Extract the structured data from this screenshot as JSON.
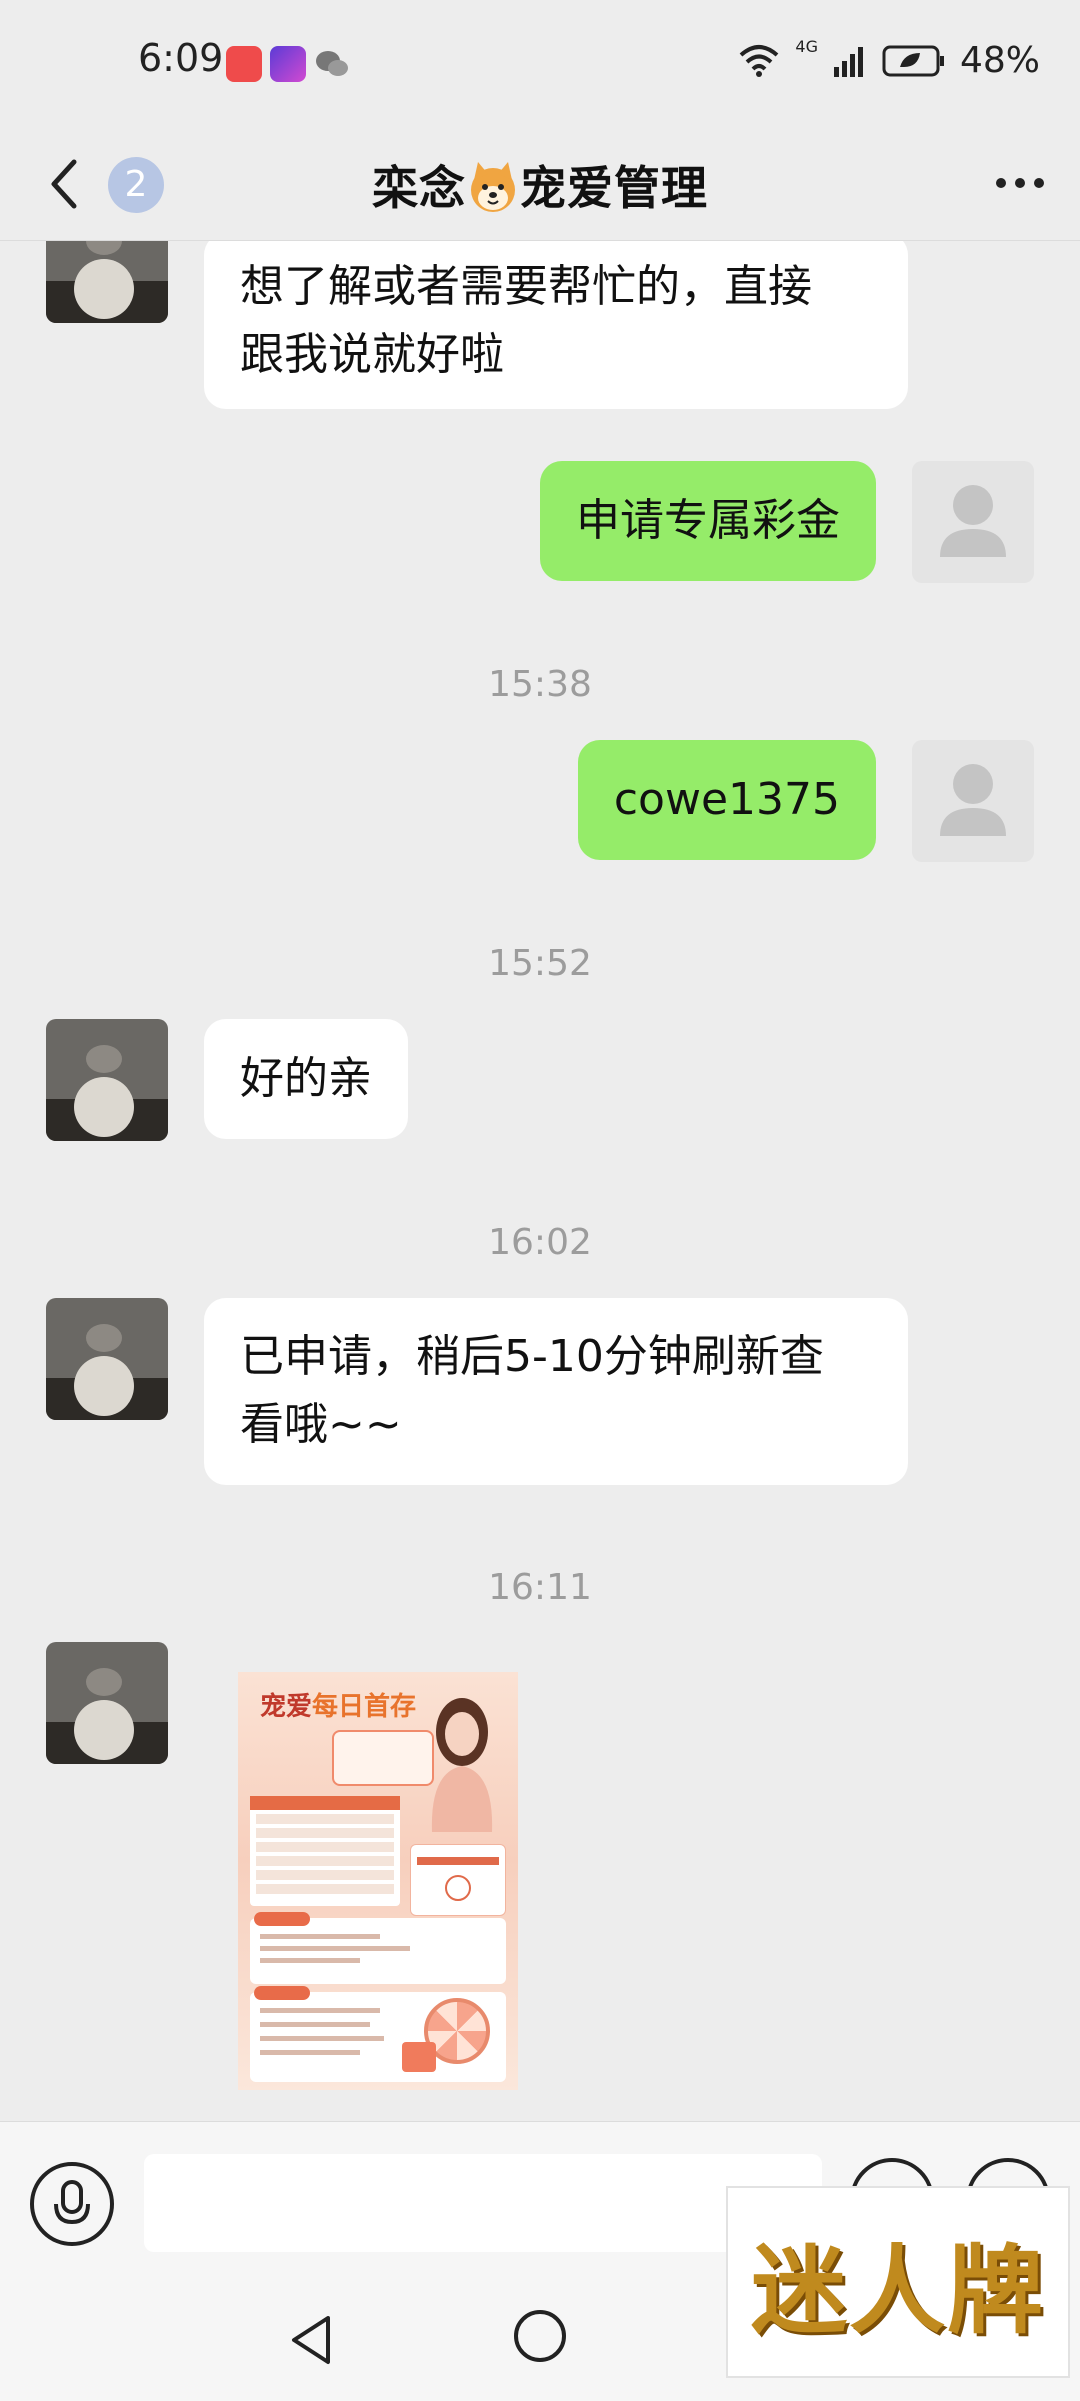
{
  "status_bar": {
    "time": "6:09",
    "battery": "48%",
    "network": "4G"
  },
  "header": {
    "unread_count": "2",
    "title_left": "栾念",
    "title_right": "宠爱管理",
    "title_emoji": "shiba-dog-emoji"
  },
  "messages": [
    {
      "id": "m1",
      "side": "in",
      "lines": [
        "想了解或者需要帮忙的，直接",
        "跟我说就好啦"
      ]
    },
    {
      "id": "m2",
      "side": "out",
      "text": "申请专属彩金"
    },
    {
      "id": "t1",
      "type": "time",
      "text": "15:38"
    },
    {
      "id": "m3",
      "side": "out",
      "text": "cowe1375"
    },
    {
      "id": "t2",
      "type": "time",
      "text": "15:52"
    },
    {
      "id": "m4",
      "side": "in",
      "text": "好的亲"
    },
    {
      "id": "t3",
      "type": "time",
      "text": "16:02"
    },
    {
      "id": "m5",
      "side": "in",
      "lines": [
        "已申请，稍后5-10分钟刷新查",
        "看哦~~"
      ]
    },
    {
      "id": "t4",
      "type": "time",
      "text": "16:11"
    },
    {
      "id": "m6",
      "side": "in",
      "type": "image",
      "poster_title_a": "宠爱",
      "poster_title_b": "每日首存"
    }
  ],
  "input_bar": {
    "input_value": "",
    "watermark_text": "迷人牌"
  },
  "colors": {
    "background": "#ededed",
    "outgoing_bubble": "#95ec69",
    "incoming_bubble": "#ffffff",
    "timestamp": "#9c9c9c"
  }
}
